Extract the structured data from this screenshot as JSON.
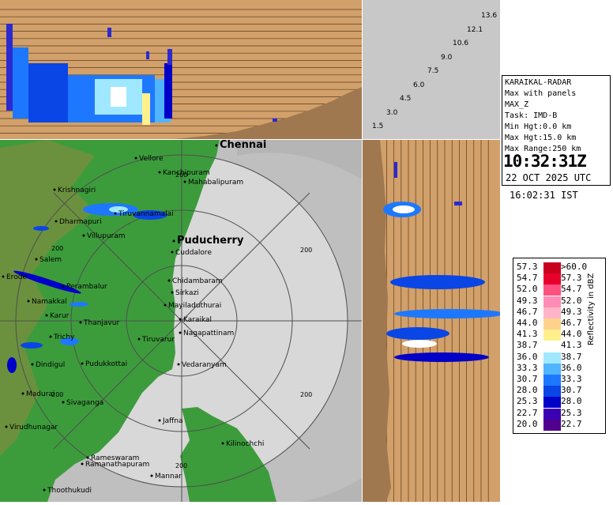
{
  "radar": {
    "station": "KARAIKAL-RADAR",
    "product": "Max with panels",
    "field": "MAX_Z",
    "task": "Task: IMD-B",
    "min_hgt": "Min Hgt:0.0 km",
    "max_hgt": "Max Hgt:15.0 km",
    "max_range": "Max Range:250 km",
    "time_utc": "10:32:31Z",
    "date_utc": "22 OCT 2025 UTC",
    "time_ist": "16:02:31 IST"
  },
  "height_scale": [
    "13.6",
    "12.1",
    "10.6",
    "9.0",
    "7.5",
    "6.0",
    "4.5",
    "3.0",
    "1.5"
  ],
  "range_ring_label": "200",
  "places": [
    {
      "name": "Chennai",
      "big": true
    },
    {
      "name": "Vellore"
    },
    {
      "name": "Kanchipuram"
    },
    {
      "name": "Mahabalipuram"
    },
    {
      "name": "Krishnagiri"
    },
    {
      "name": "Tiruvannamalai"
    },
    {
      "name": "Dharmapuri"
    },
    {
      "name": "Villupuram"
    },
    {
      "name": "Puducherry",
      "big": true
    },
    {
      "name": "Cuddalore"
    },
    {
      "name": "Salem"
    },
    {
      "name": "Erode"
    },
    {
      "name": "Perambalur"
    },
    {
      "name": "Chidambaram"
    },
    {
      "name": "Sirkazi"
    },
    {
      "name": "Namakkal"
    },
    {
      "name": "Karur"
    },
    {
      "name": "Mayiladuthurai"
    },
    {
      "name": "Karaikal"
    },
    {
      "name": "Thanjavur"
    },
    {
      "name": "Nagapattinam"
    },
    {
      "name": "Tiruvarur"
    },
    {
      "name": "Trichy"
    },
    {
      "name": "Dindigul"
    },
    {
      "name": "Pudukkottai"
    },
    {
      "name": "Vedaranyam"
    },
    {
      "name": "Madurai"
    },
    {
      "name": "Sivaganga"
    },
    {
      "name": "Virudhunagar"
    },
    {
      "name": "Jaffna"
    },
    {
      "name": "Kilinochchi"
    },
    {
      "name": "Ramanathapuram"
    },
    {
      "name": "Rameswaram"
    },
    {
      "name": "Mannar"
    },
    {
      "name": "Thoothukudi"
    }
  ],
  "legend": {
    "title": "Reflectivity in dBZ",
    "rows": [
      {
        "left": "57.3",
        "right": ">60.0",
        "color": "#c8001e"
      },
      {
        "left": "54.7",
        "right": "57.3",
        "color": "#e8002c"
      },
      {
        "left": "52.0",
        "right": "54.7",
        "color": "#ff5080"
      },
      {
        "left": "49.3",
        "right": "52.0",
        "color": "#ff8cb4"
      },
      {
        "left": "46.7",
        "right": "49.3",
        "color": "#ffb4c8"
      },
      {
        "left": "44.0",
        "right": "46.7",
        "color": "#ffd28c"
      },
      {
        "left": "41.3",
        "right": "44.0",
        "color": "#fff08c"
      },
      {
        "left": "38.7",
        "right": "41.3",
        "color": "#ffffff"
      },
      {
        "left": "36.0",
        "right": "38.7",
        "color": "#a0e8ff"
      },
      {
        "left": "33.3",
        "right": "36.0",
        "color": "#50b4ff"
      },
      {
        "left": "30.7",
        "right": "33.3",
        "color": "#1e78ff"
      },
      {
        "left": "28.0",
        "right": "30.7",
        "color": "#0a46e6"
      },
      {
        "left": "25.3",
        "right": "28.0",
        "color": "#0000c8"
      },
      {
        "left": "22.7",
        "right": "25.3",
        "color": "#3c00b4"
      },
      {
        "left": "20.0",
        "right": "22.7",
        "color": "#50008c"
      }
    ]
  },
  "colors": {
    "panel_bg": "#d2a06a",
    "land": "#3c9c3c",
    "range_disk": "#d8d8d8",
    "grid": "#505050"
  }
}
